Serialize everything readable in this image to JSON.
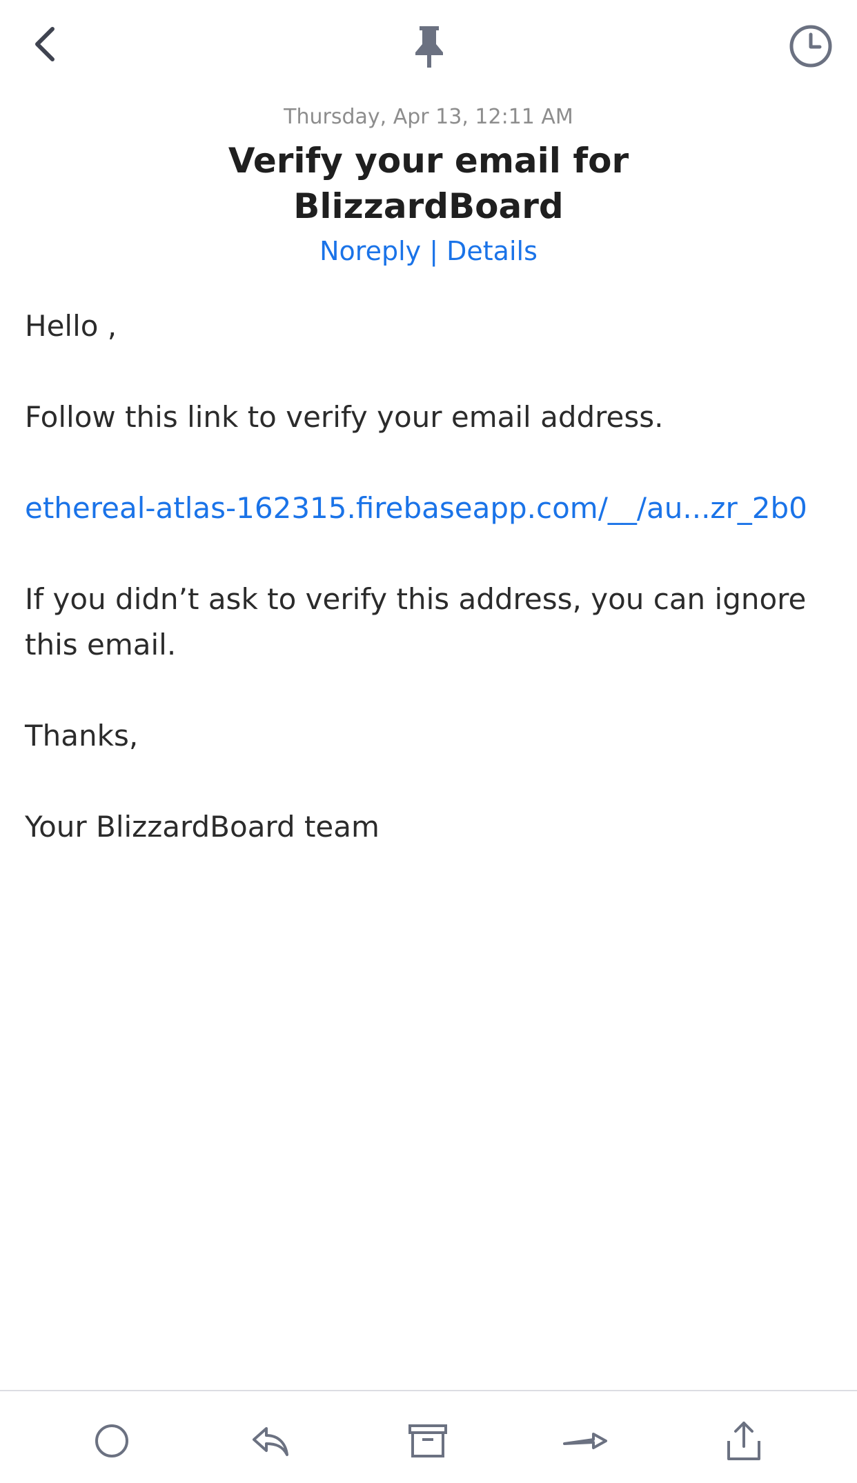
{
  "topbar": {
    "back_icon": "chevron-left-icon",
    "pin_icon": "pin-icon",
    "snooze_icon": "clock-icon"
  },
  "email": {
    "date": "Thursday, Apr 13, 12:11 AM",
    "subject": "Verify your email for BlizzardBoard",
    "sender": "Noreply",
    "separator": "|",
    "details": "Details",
    "greeting": "Hello ,",
    "instruction": "Follow this link to verify your email address.",
    "link": "ethereal-atlas-162315.firebaseapp.com/__/au...zr_2b0",
    "ignore_note": "If you didn’t ask to verify this address, you can ignore this email.",
    "thanks": "Thanks,",
    "signature": "Your BlizzardBoard team"
  },
  "toolbar": {
    "items": [
      "circle-icon",
      "reply-icon",
      "archive-icon",
      "forward-icon",
      "share-icon"
    ]
  },
  "colors": {
    "accent": "#1a73e8",
    "icon": "#6b7181",
    "date": "#8d8d8d",
    "text": "#2b2b2b"
  }
}
